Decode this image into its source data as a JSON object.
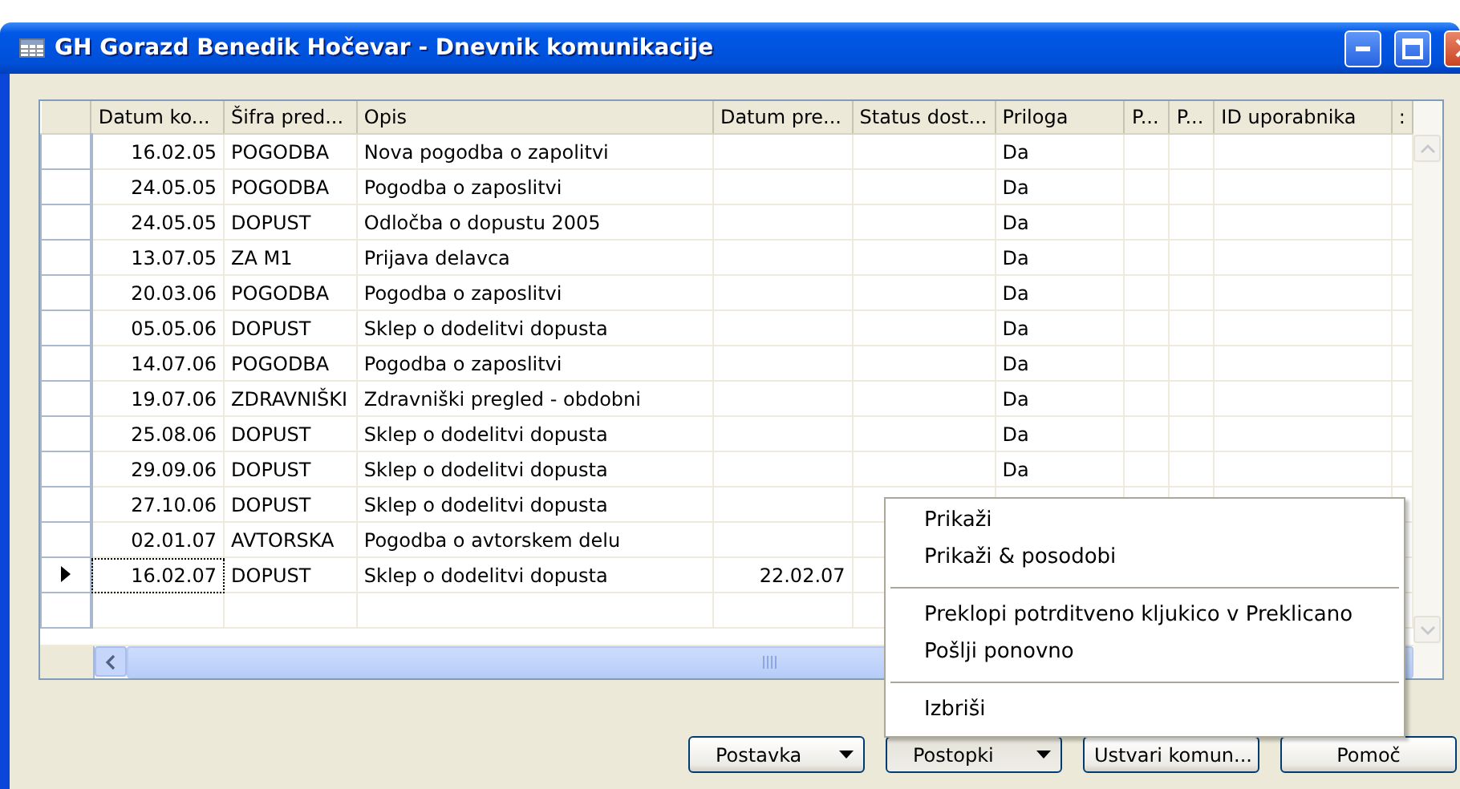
{
  "window": {
    "title": "GH Gorazd Benedik Hočevar - Dnevnik komunikacije"
  },
  "table": {
    "columns": [
      "Datum ko...",
      "Šifra pred...",
      "Opis",
      "Datum pre...",
      "Status dost...",
      "Priloga",
      "P...",
      "P...",
      "ID uporabnika",
      ":"
    ],
    "rows": [
      {
        "current": false,
        "datum_ko": "16.02.05",
        "sifra": "POGODBA",
        "opis": "Nova pogodba o zapolitvi",
        "priloga": "Da"
      },
      {
        "current": false,
        "datum_ko": "24.05.05",
        "sifra": "POGODBA",
        "opis": "Pogodba o zaposlitvi",
        "priloga": "Da"
      },
      {
        "current": false,
        "datum_ko": "24.05.05",
        "sifra": "DOPUST",
        "opis": "Odločba o dopustu 2005",
        "priloga": "Da"
      },
      {
        "current": false,
        "datum_ko": "13.07.05",
        "sifra": "ZA M1",
        "opis": "Prijava delavca",
        "priloga": "Da"
      },
      {
        "current": false,
        "datum_ko": "20.03.06",
        "sifra": "POGODBA",
        "opis": "Pogodba o zaposlitvi",
        "priloga": "Da"
      },
      {
        "current": false,
        "datum_ko": "05.05.06",
        "sifra": "DOPUST",
        "opis": "Sklep o dodelitvi dopusta",
        "priloga": "Da"
      },
      {
        "current": false,
        "datum_ko": "14.07.06",
        "sifra": "POGODBA",
        "opis": "Pogodba o zaposlitvi",
        "priloga": "Da"
      },
      {
        "current": false,
        "datum_ko": "19.07.06",
        "sifra": "ZDRAVNIŠKI",
        "opis": "Zdravniški pregled - obdobni",
        "priloga": "Da"
      },
      {
        "current": false,
        "datum_ko": "25.08.06",
        "sifra": "DOPUST",
        "opis": "Sklep o dodelitvi dopusta",
        "priloga": "Da"
      },
      {
        "current": false,
        "datum_ko": "29.09.06",
        "sifra": "DOPUST",
        "opis": "Sklep o dodelitvi dopusta",
        "priloga": "Da"
      },
      {
        "current": false,
        "datum_ko": "27.10.06",
        "sifra": "DOPUST",
        "opis": "Sklep o dodelitvi dopusta"
      },
      {
        "current": false,
        "datum_ko": "02.01.07",
        "sifra": "AVTORSKA",
        "opis": "Pogodba o avtorskem delu"
      },
      {
        "current": true,
        "datum_ko": "16.02.07",
        "sifra": "DOPUST",
        "opis": "Sklep o dodelitvi dopusta",
        "datum_pre": "22.02.07"
      }
    ]
  },
  "menu": {
    "groups": [
      [
        "Prikaži",
        "Prikaži & posodobi"
      ],
      [
        "Preklopi potrditveno kljukico v Preklicano",
        "Pošlji ponovno"
      ],
      [
        "Izbriši"
      ]
    ]
  },
  "buttons": [
    {
      "label": "Postavka",
      "kind": "dropdown",
      "pressed": false
    },
    {
      "label": "Postopki",
      "kind": "dropdown",
      "pressed": true
    },
    {
      "label": "Ustvari komun...",
      "kind": "plain",
      "pressed": false
    },
    {
      "label": "Pomoč",
      "kind": "plain",
      "pressed": false
    }
  ]
}
